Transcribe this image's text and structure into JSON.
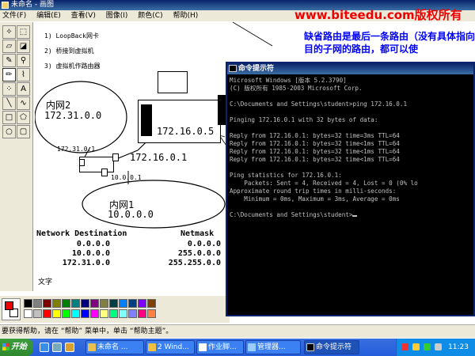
{
  "paint": {
    "title": "未命名 - 画图",
    "menu": [
      "文件(F)",
      "编辑(E)",
      "查看(V)",
      "图像(I)",
      "颜色(C)",
      "帮助(H)"
    ],
    "status_text": "要获得帮助，请在 “帮助” 菜单中，单击 “帮助主题”。",
    "text_label": "文字"
  },
  "watermark": "www.biteedu.com版权所有",
  "canvas": {
    "steps": [
      "1) LoopBack网卡",
      "2) 桥接到虚拟机",
      "3) 虚拟机作路由器"
    ],
    "notes": "缺省路由是最后一条路由（没有具体指向目的子网的路由，都可以使",
    "net2_label": "内网2",
    "net2_ip": "172.31.0.0",
    "net1_label": "内网1",
    "net1_ip": "10.0.0.0",
    "router_ip_top": "172.16.0.5",
    "router_ip_mid": "172.16.0.1",
    "router_ip_left": "172.31.0.1",
    "router_ip_bottom": "10.0.0.1",
    "marker_1": "1",
    "route_table": {
      "col1": "Network Destination",
      "col2": "Netmask",
      "rows": [
        {
          "dest": "0.0.0.0",
          "mask": "0.0.0.0"
        },
        {
          "dest": "10.0.0.0",
          "mask": "255.0.0.0"
        },
        {
          "dest": "172.31.0.0",
          "mask": "255.255.0.0"
        }
      ]
    }
  },
  "cmd": {
    "title": "命令提示符",
    "lines": [
      "Microsoft Windows [版本 5.2.3790]",
      "(C) 版权所有 1985-2003 Microsoft Corp.",
      "",
      "C:\\Documents and Settings\\student>ping 172.16.0.1",
      "",
      "Pinging 172.16.0.1 with 32 bytes of data:",
      "",
      "Reply from 172.16.0.1: bytes=32 time=3ms TTL=64",
      "Reply from 172.16.0.1: bytes=32 time<1ms TTL=64",
      "Reply from 172.16.0.1: bytes=32 time<1ms TTL=64",
      "Reply from 172.16.0.1: bytes=32 time<1ms TTL=64",
      "",
      "Ping statistics for 172.16.0.1:",
      "    Packets: Sent = 4, Received = 4, Lost = 0 (0% lo",
      "Approximate round trip times in milli-seconds:",
      "    Minimum = 0ms, Maximum = 3ms, Average = 0ms",
      "",
      "C:\\Documents and Settings\\student>"
    ]
  },
  "palette_colors": [
    "#000000",
    "#808080",
    "#800000",
    "#808000",
    "#008000",
    "#008080",
    "#000080",
    "#800080",
    "#808040",
    "#004040",
    "#0080ff",
    "#004080",
    "#8000ff",
    "#804000",
    "#ffffff",
    "#c0c0c0",
    "#ff0000",
    "#ffff00",
    "#00ff00",
    "#00ffff",
    "#0000ff",
    "#ff00ff",
    "#ffff80",
    "#00ff80",
    "#80ffff",
    "#8080ff",
    "#ff0080",
    "#ff8040"
  ],
  "taskbar": {
    "start_label": "开始",
    "buttons": [
      "未命名 ...",
      "2 Wind...",
      "作业脚...",
      "管理器...",
      "命令提示符"
    ],
    "clock": "11:23"
  }
}
